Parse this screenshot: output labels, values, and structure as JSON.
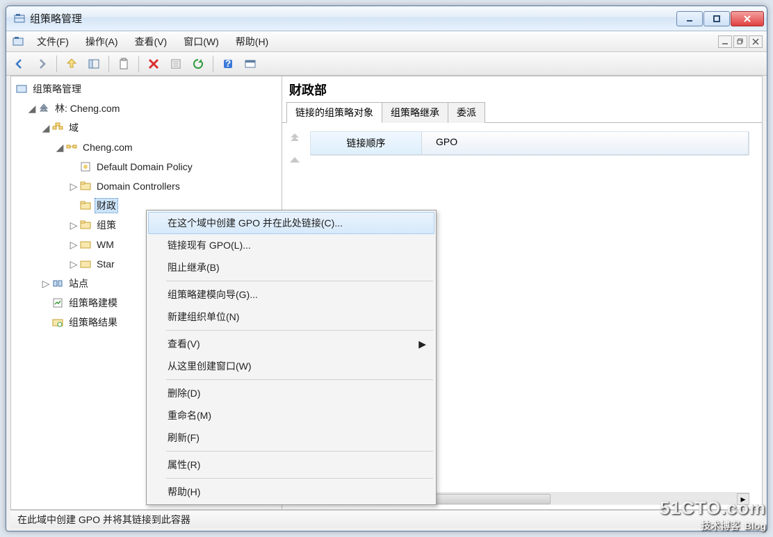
{
  "window": {
    "title": "组策略管理"
  },
  "menu": {
    "file": "文件(F)",
    "action": "操作(A)",
    "view": "查看(V)",
    "window": "窗口(W)",
    "help": "帮助(H)"
  },
  "tree": {
    "root": "组策略管理",
    "forest": "林: Cheng.com",
    "domains": "域",
    "domain_name": "Cheng.com",
    "default_policy": "Default Domain Policy",
    "domain_controllers": "Domain Controllers",
    "ou_finance": "财政",
    "ou_group": "组策",
    "wmi": "WM",
    "starter": "Star",
    "sites": "站点",
    "modeling": "组策略建模",
    "results": "组策略结果"
  },
  "details": {
    "heading": "财政部",
    "tabs": {
      "linked": "链接的组策略对象",
      "inheritance": "组策略继承",
      "delegation": "委派"
    },
    "columns": {
      "link_order": "链接顺序",
      "gpo": "GPO"
    }
  },
  "context_menu": {
    "create_link": "在这个域中创建 GPO 并在此处链接(C)...",
    "link_existing": "链接现有 GPO(L)...",
    "block_inheritance": "阻止继承(B)",
    "modeling_wizard": "组策略建模向导(G)...",
    "new_ou": "新建组织单位(N)",
    "view": "查看(V)",
    "new_window": "从这里创建窗口(W)",
    "delete": "删除(D)",
    "rename": "重命名(M)",
    "refresh": "刷新(F)",
    "properties": "属性(R)",
    "help": "帮助(H)"
  },
  "statusbar": {
    "text": "在此域中创建 GPO 并将其链接到此容器"
  },
  "watermark": {
    "line1": "51CTO.com",
    "line2": "技术博客",
    "blog": "Blog"
  }
}
